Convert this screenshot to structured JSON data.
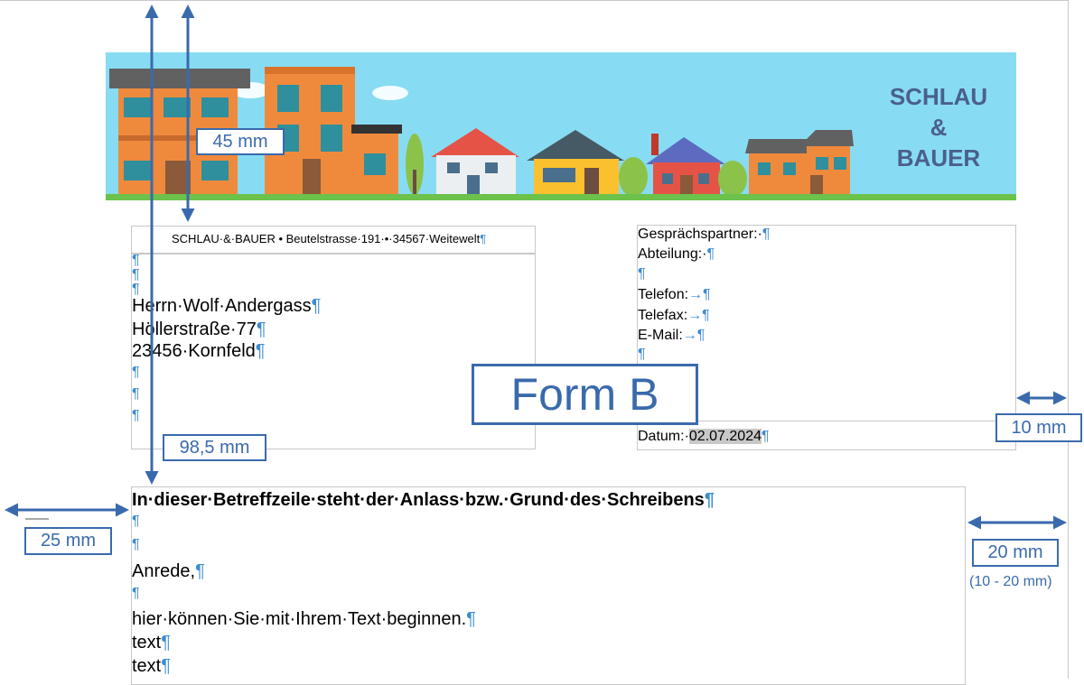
{
  "banner": {
    "brand_line1": "SCHLAU",
    "brand_line2": "&",
    "brand_line3": "BAUER",
    "colors": {
      "sky": "#87dcf3",
      "grass": "#6cc24a",
      "brand_text": "#4b5f8d"
    }
  },
  "sender_line": "SCHLAU·&·BAUER • Beutelstrasse·191·•·34567·Weitewelt",
  "address": {
    "name": "Herrn·Wolf·Andergass",
    "street": "Höllerstraße·77",
    "city": "23456·Kornfeld"
  },
  "info": {
    "contact_label": "Gesprächspartner:·",
    "department_label": "Abteilung:·",
    "phone_label": "Telefon:",
    "fax_label": "Telefax:",
    "email_label": "E-Mail:",
    "date_label": "Datum:·",
    "date_value": "02.07.2024"
  },
  "body": {
    "subject": "In·dieser·Betreffzeile·steht·der·Anlass·bzw.·Grund·des·Schreibens",
    "salutation": "Anrede,",
    "line1": "hier·können·Sie·mit·Ihrem·Text·beginnen.",
    "line2": "text",
    "line3": "text"
  },
  "annotations": {
    "form": "Form B",
    "top_margin": "45 mm",
    "address_offset": "98,5 mm",
    "left_margin": "25 mm",
    "info_right_margin": "10 mm",
    "body_right_margin": "20 mm",
    "body_right_range": "(10 - 20 mm)",
    "accent_color": "#3a6aad"
  },
  "pilcrow": "¶",
  "arrow": "→"
}
